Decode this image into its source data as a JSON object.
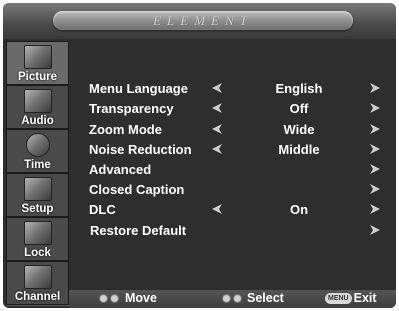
{
  "header": {
    "brand": "ELEMENT"
  },
  "sidebar": {
    "items": [
      {
        "label": "Picture",
        "icon": "picture-icon",
        "active": true
      },
      {
        "label": "Audio",
        "icon": "audio-icon",
        "active": false
      },
      {
        "label": "Time",
        "icon": "clock-icon",
        "active": false
      },
      {
        "label": "Setup",
        "icon": "setup-icon",
        "active": false
      },
      {
        "label": "Lock",
        "icon": "lock-icon",
        "active": false
      },
      {
        "label": "Channel",
        "icon": "channel-icon",
        "active": false
      }
    ]
  },
  "menu": {
    "rows": [
      {
        "label": "Menu Language",
        "value": "English",
        "left_arrow": true
      },
      {
        "label": "Transparency",
        "value": "Off",
        "left_arrow": true
      },
      {
        "label": "Zoom Mode",
        "value": "Wide",
        "left_arrow": true
      },
      {
        "label": "Noise Reduction",
        "value": "Middle",
        "left_arrow": true
      },
      {
        "label": "Advanced",
        "value": "",
        "left_arrow": false
      },
      {
        "label": "Closed Caption",
        "value": "",
        "left_arrow": false
      },
      {
        "label": "DLC",
        "value": "On",
        "left_arrow": true
      },
      {
        "label": "Restore Default",
        "value": "",
        "left_arrow": false
      }
    ]
  },
  "footer": {
    "move_label": "Move",
    "select_label": "Select",
    "menu_key": "MENU",
    "exit_label": "Exit"
  },
  "colors": {
    "background": "#2e2e2e",
    "text": "#ffffff",
    "sidebar": "#5a5a5a"
  }
}
